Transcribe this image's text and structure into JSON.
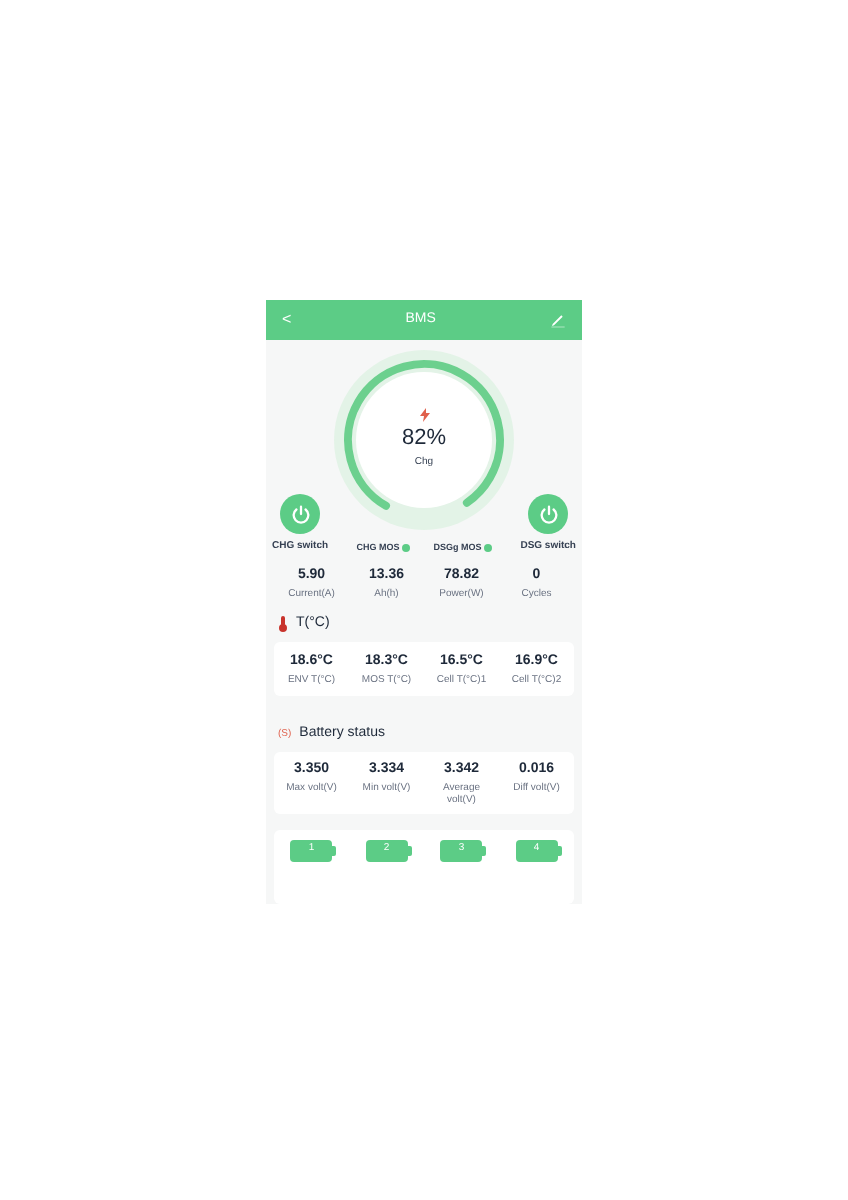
{
  "header": {
    "back": "<",
    "title": "BMS"
  },
  "gauge": {
    "level": 0.82,
    "percent": "82%",
    "status": "Chg"
  },
  "switches": [
    {
      "label": "CHG switch",
      "on": true
    },
    {
      "label": "DSG switch",
      "on": true
    }
  ],
  "mos": [
    {
      "label": "CHG MOS",
      "on": true
    },
    {
      "label": "DSGg MOS",
      "on": true
    }
  ],
  "stats": [
    {
      "value": "5.90",
      "label": "Current(A)"
    },
    {
      "value": "13.36",
      "label": "Ah(h)"
    },
    {
      "value": "78.82",
      "label": "Power(W)"
    },
    {
      "value": "0",
      "label": "Cycles"
    }
  ],
  "temperature": {
    "title": "T(°C)",
    "items": [
      {
        "value": "18.6°C",
        "label": "ENV T(°C)"
      },
      {
        "value": "18.3°C",
        "label": "MOS T(°C)"
      },
      {
        "value": "16.5°C",
        "label": "Cell T(°C)1"
      },
      {
        "value": "16.9°C",
        "label": "Cell T(°C)2"
      }
    ]
  },
  "battery": {
    "icon": "(S)",
    "title": "Battery status",
    "items": [
      {
        "value": "3.350",
        "label": "Max volt(V)"
      },
      {
        "value": "3.334",
        "label": "Min volt(V)"
      },
      {
        "value": "3.342",
        "label": "Average volt(V)"
      },
      {
        "value": "0.016",
        "label": "Diff volt(V)"
      }
    ]
  },
  "cells": [
    "1",
    "2",
    "3",
    "4"
  ]
}
